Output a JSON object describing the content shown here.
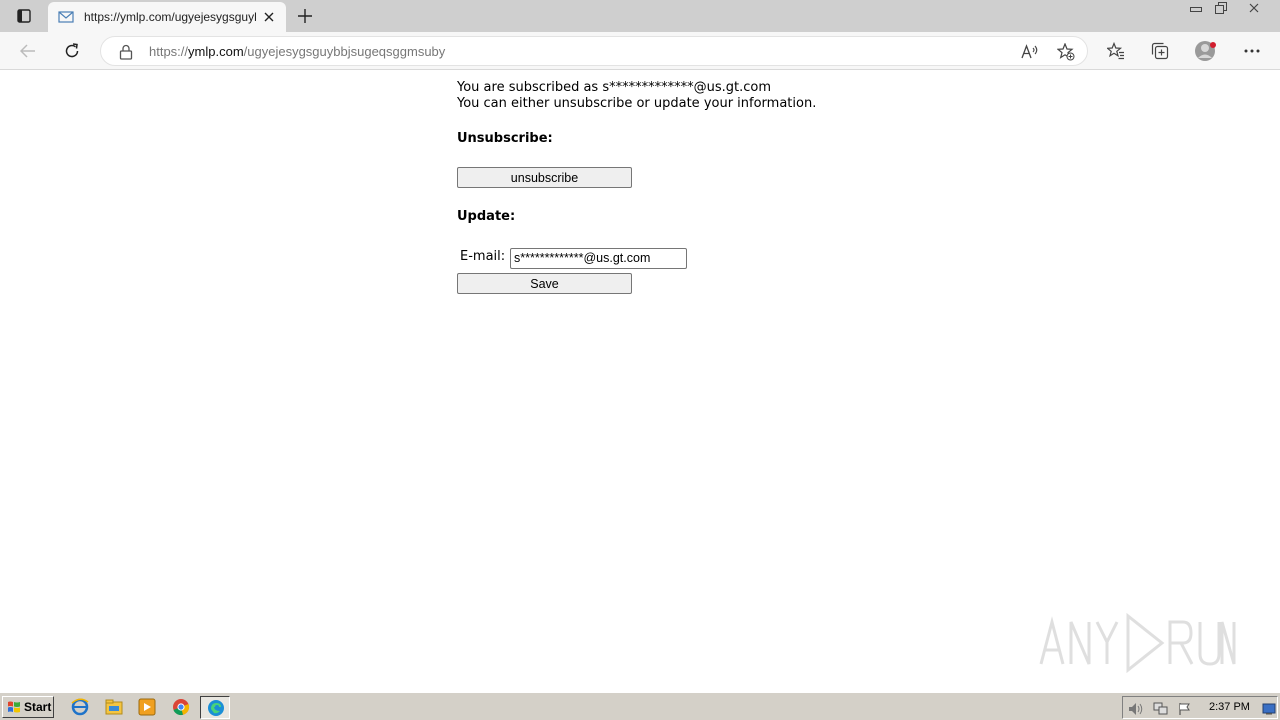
{
  "browser": {
    "tab_title": "https://ymlp.com/ugyejesygsguybbjsugeqsggmsuby",
    "address_host_prefix": "https://",
    "address_host": "ymlp.com",
    "address_path": "/ugyejesygsguybbjsugeqsggmsuby"
  },
  "page": {
    "subscribed_line": "You are subscribed as s*************@us.gt.com",
    "info_line": "You can either unsubscribe or update your information.",
    "unsubscribe_heading": "Unsubscribe:",
    "unsubscribe_button": "unsubscribe",
    "update_heading": "Update:",
    "email_label": "E-mail:",
    "email_value": "s*************@us.gt.com",
    "save_button": "Save"
  },
  "watermark": "ANY RUN",
  "taskbar": {
    "start_label": "Start",
    "clock": "2:37 PM"
  }
}
